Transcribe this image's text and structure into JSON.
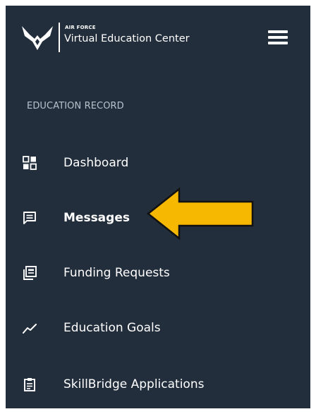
{
  "header": {
    "brand_small": "AIR FORCE",
    "brand_title": "Virtual Education Center",
    "logo_icon": "air-force-wing-icon",
    "menu_icon": "hamburger-menu-icon"
  },
  "sidebar": {
    "section_heading": "EDUCATION RECORD",
    "items": [
      {
        "label": "Dashboard",
        "icon": "dashboard-grid-icon",
        "active": false
      },
      {
        "label": "Messages",
        "icon": "message-icon",
        "active": true
      },
      {
        "label": "Funding Requests",
        "icon": "document-stack-icon",
        "active": false
      },
      {
        "label": "Education Goals",
        "icon": "trend-line-icon",
        "active": false
      },
      {
        "label": "SkillBridge Applications",
        "icon": "clipboard-icon",
        "active": false
      }
    ]
  },
  "annotation": {
    "icon": "callout-arrow-icon",
    "fill": "#f6b800",
    "stroke": "#111111"
  },
  "colors": {
    "panel_background": "#232e3c",
    "text": "#ffffff",
    "heading_text": "#b8c2ce"
  }
}
